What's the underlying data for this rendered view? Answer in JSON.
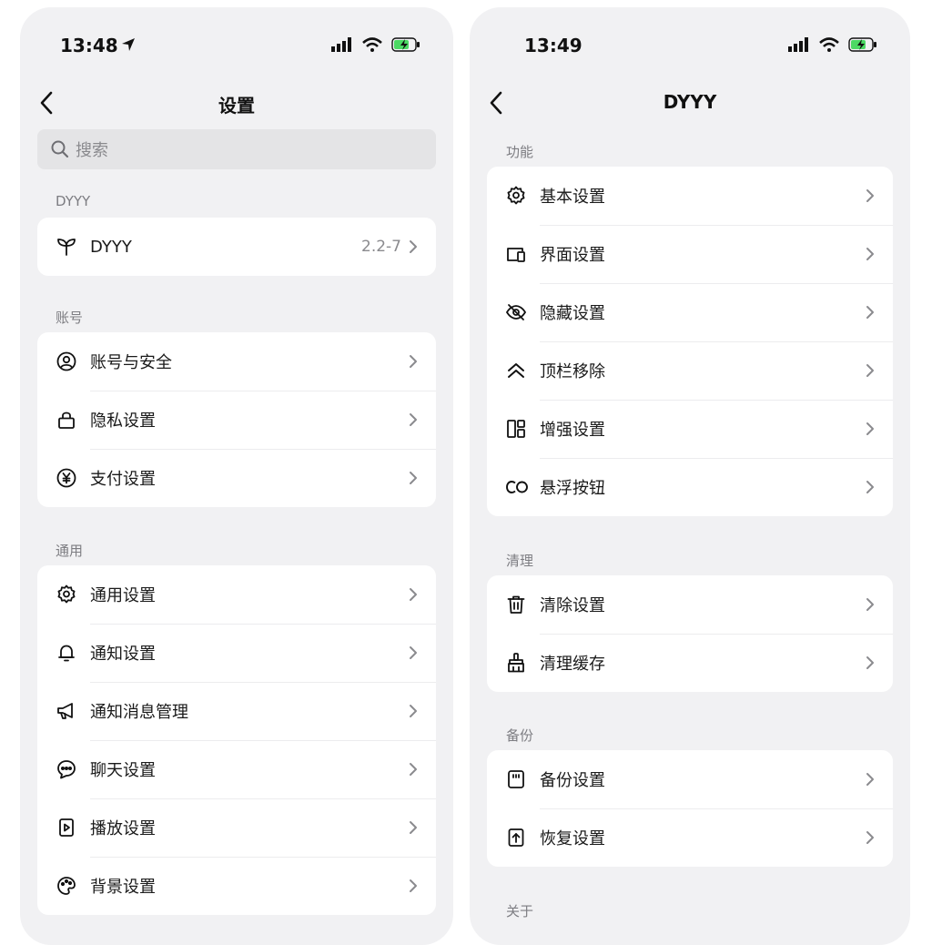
{
  "left": {
    "status": {
      "time": "13:48"
    },
    "nav": {
      "title": "设置"
    },
    "search": {
      "placeholder": "搜索"
    },
    "sections": [
      {
        "title": "DYYY",
        "items": [
          {
            "label": "DYYY",
            "value": "2.2-7",
            "icon": "sprout-icon"
          }
        ]
      },
      {
        "title": "账号",
        "items": [
          {
            "label": "账号与安全",
            "icon": "user-circle-icon"
          },
          {
            "label": "隐私设置",
            "icon": "lock-icon"
          },
          {
            "label": "支付设置",
            "icon": "yen-circle-icon"
          }
        ]
      },
      {
        "title": "通用",
        "items": [
          {
            "label": "通用设置",
            "icon": "gear-icon"
          },
          {
            "label": "通知设置",
            "icon": "bell-icon"
          },
          {
            "label": "通知消息管理",
            "icon": "megaphone-icon"
          },
          {
            "label": "聊天设置",
            "icon": "chat-bubble-icon"
          },
          {
            "label": "播放设置",
            "icon": "play-file-icon"
          },
          {
            "label": "背景设置",
            "icon": "palette-icon"
          }
        ]
      }
    ]
  },
  "right": {
    "status": {
      "time": "13:49"
    },
    "nav": {
      "title": "DYYY"
    },
    "sections": [
      {
        "title": "功能",
        "items": [
          {
            "label": "基本设置",
            "icon": "gear-icon"
          },
          {
            "label": "界面设置",
            "icon": "devices-icon"
          },
          {
            "label": "隐藏设置",
            "icon": "eye-slash-icon"
          },
          {
            "label": "顶栏移除",
            "icon": "double-chevron-up-icon"
          },
          {
            "label": "增强设置",
            "icon": "layout-grid-icon"
          },
          {
            "label": "悬浮按钮",
            "icon": "co-icon"
          }
        ]
      },
      {
        "title": "清理",
        "items": [
          {
            "label": "清除设置",
            "icon": "trash-icon"
          },
          {
            "label": "清理缓存",
            "icon": "broom-icon"
          }
        ]
      },
      {
        "title": "备份",
        "items": [
          {
            "label": "备份设置",
            "icon": "sd-card-icon"
          },
          {
            "label": "恢复设置",
            "icon": "upload-file-icon"
          }
        ]
      },
      {
        "title": "关于",
        "items": []
      }
    ]
  }
}
